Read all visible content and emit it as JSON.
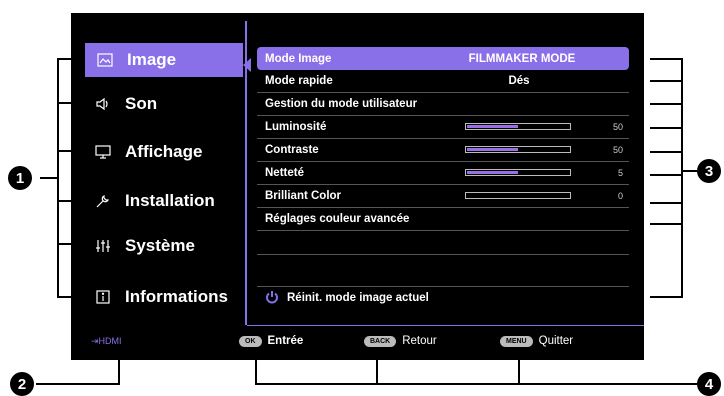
{
  "sidebar": {
    "items": [
      {
        "label": "Image",
        "icon": "image-icon"
      },
      {
        "label": "Son",
        "icon": "speaker-icon"
      },
      {
        "label": "Affichage",
        "icon": "monitor-icon"
      },
      {
        "label": "Installation",
        "icon": "wrench-icon"
      },
      {
        "label": "Système",
        "icon": "sliders-icon"
      },
      {
        "label": "Informations",
        "icon": "info-icon"
      }
    ]
  },
  "menu": {
    "rows": [
      {
        "label": "Mode Image",
        "value": "FILMMAKER MODE"
      },
      {
        "label": "Mode rapide",
        "value": "Dés"
      },
      {
        "label": "Gestion du mode utilisateur",
        "value": ""
      },
      {
        "label": "Luminosité",
        "value": "50",
        "level": 0.5
      },
      {
        "label": "Contraste",
        "value": "50",
        "level": 0.5
      },
      {
        "label": "Netteté",
        "value": "5",
        "level": 0.5
      },
      {
        "label": "Brilliant Color",
        "value": "0",
        "level": 0
      },
      {
        "label": "Réglages couleur avancée",
        "value": ""
      }
    ],
    "reset_label": "Réinit. mode image actuel"
  },
  "footer": {
    "source": "HDMI",
    "ok_key": "OK",
    "ok_label": "Entrée",
    "back_key": "BACK",
    "back_label": "Retour",
    "menu_key": "MENU",
    "menu_label": "Quitter"
  },
  "callouts": [
    "1",
    "2",
    "3",
    "4"
  ],
  "colors": {
    "accent": "#8a70e8",
    "background": "#000000"
  }
}
